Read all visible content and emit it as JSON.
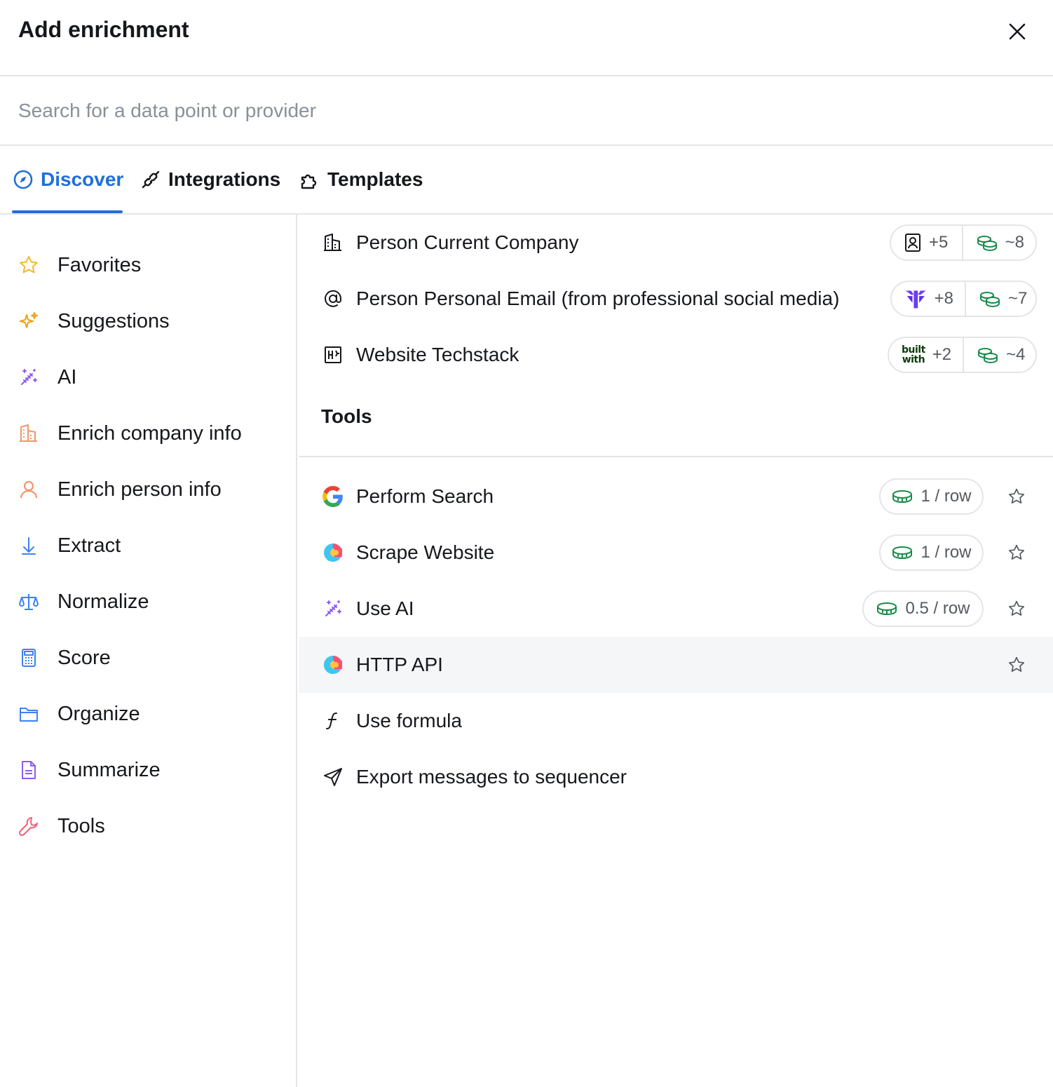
{
  "modal": {
    "title": "Add enrichment"
  },
  "search": {
    "placeholder": "Search for a data point or provider"
  },
  "tabs": [
    {
      "label": "Discover",
      "icon": "compass-icon",
      "active": true
    },
    {
      "label": "Integrations",
      "icon": "plug-icon",
      "active": false
    },
    {
      "label": "Templates",
      "icon": "puzzle-icon",
      "active": false
    }
  ],
  "sidebar": {
    "items": [
      {
        "label": "Favorites",
        "icon": "star-icon",
        "color": "#f5b82e"
      },
      {
        "label": "Suggestions",
        "icon": "sparkles-icon",
        "color": "#e8a317"
      },
      {
        "label": "AI",
        "icon": "magic-wand-icon",
        "color": "#8b5cf6"
      },
      {
        "label": "Enrich company info",
        "icon": "building-icon",
        "color": "#f2966b"
      },
      {
        "label": "Enrich person info",
        "icon": "person-icon",
        "color": "#f2966b"
      },
      {
        "label": "Extract",
        "icon": "arrow-down-icon",
        "color": "#3b82f6"
      },
      {
        "label": "Normalize",
        "icon": "scale-icon",
        "color": "#3b82f6"
      },
      {
        "label": "Score",
        "icon": "calculator-icon",
        "color": "#3b82f6"
      },
      {
        "label": "Organize",
        "icon": "folder-icon",
        "color": "#3b82f6"
      },
      {
        "label": "Summarize",
        "icon": "document-icon",
        "color": "#8b5cf6"
      },
      {
        "label": "Tools",
        "icon": "wrench-icon",
        "color": "#f06277"
      }
    ]
  },
  "enrichments": [
    {
      "label": "Person Current Company",
      "icon": "building-icon",
      "providers": "+5",
      "provider_icon": "contact-card-icon",
      "credits": "~8"
    },
    {
      "label": "Person Personal Email (from professional social media)",
      "icon": "at-sign-icon",
      "providers": "+8",
      "provider_icon": "provider-logo-icon",
      "credits": "~7"
    },
    {
      "label": "Website Techstack",
      "icon": "techstack-icon",
      "providers": "+2",
      "provider_icon": "builtwith-logo",
      "provider_logo_text": [
        "built",
        "with"
      ],
      "credits": "~4"
    }
  ],
  "tools_section": {
    "title": "Tools",
    "items": [
      {
        "label": "Perform Search",
        "icon": "google-icon",
        "cost": "1 / row"
      },
      {
        "label": "Scrape Website",
        "icon": "clay-logo-icon",
        "cost": "1 / row"
      },
      {
        "label": "Use AI",
        "icon": "magic-wand-icon",
        "cost": "0.5 / row"
      },
      {
        "label": "HTTP API",
        "icon": "clay-logo-icon",
        "cost": ""
      },
      {
        "label": "Use formula",
        "icon": "function-icon",
        "cost": ""
      },
      {
        "label": "Export messages to sequencer",
        "icon": "send-icon",
        "cost": ""
      }
    ]
  },
  "colors": {
    "accent": "#1f6fd9",
    "credit_green": "#1a8a4a",
    "border": "#e3e5e8",
    "hover_row": "#f5f6f8"
  }
}
